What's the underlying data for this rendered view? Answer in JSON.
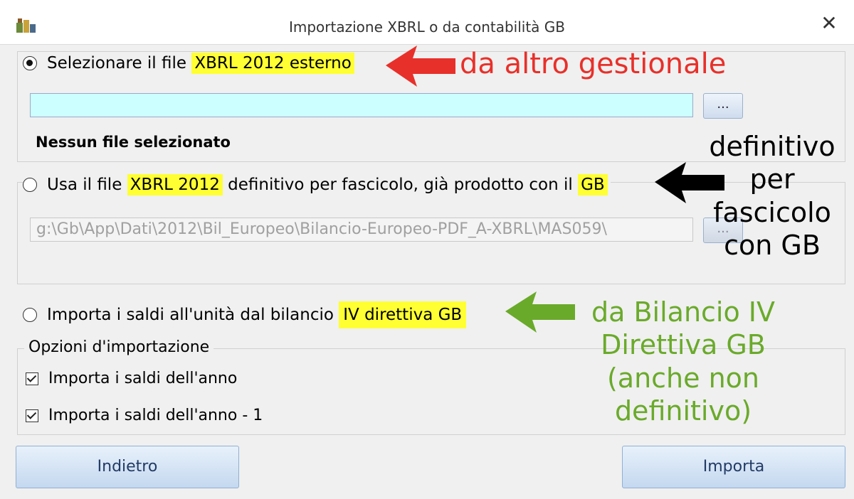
{
  "window": {
    "title": "Importazione XBRL o da contabilità GB",
    "close_glyph": "✕"
  },
  "option1": {
    "label_prefix": "Selezionare il file ",
    "label_highlight": "XBRL 2012 esterno",
    "file_value": "",
    "browse_label": "...",
    "status": "Nessun file selezionato",
    "selected": true
  },
  "option2": {
    "label_prefix": "Usa il file ",
    "label_highlight1": "XBRL 2012",
    "label_middle": " definitivo per fascicolo, già prodotto con il ",
    "label_highlight2": "GB",
    "file_value": "g:\\Gb\\App\\Dati\\2012\\Bil_Europeo\\Bilancio-Europeo-PDF_A-XBRL\\MAS059\\",
    "browse_label": "...",
    "selected": false
  },
  "option3": {
    "label_prefix": "Importa i saldi all'unità dal bilancio ",
    "label_highlight": "IV direttiva GB",
    "selected": false
  },
  "import_options": {
    "legend": "Opzioni d'importazione",
    "items": [
      {
        "label": "Importa i saldi dell'anno",
        "checked": true
      },
      {
        "label": "Importa i saldi dell'anno - 1",
        "checked": true
      }
    ]
  },
  "buttons": {
    "back": "Indietro",
    "import": "Importa"
  },
  "annotations": {
    "red": {
      "text": "da altro gestionale",
      "color": "#e8302a"
    },
    "black": {
      "lines": [
        "definitivo",
        "per",
        "fascicolo",
        "con GB"
      ],
      "color": "#000000"
    },
    "green": {
      "lines": [
        "da Bilancio IV",
        "Direttiva GB",
        "(anche non",
        "definitivo)"
      ],
      "color": "#6aaa2a"
    }
  },
  "colors": {
    "highlight": "#ffff33",
    "input_active_bg": "#ccffff"
  }
}
